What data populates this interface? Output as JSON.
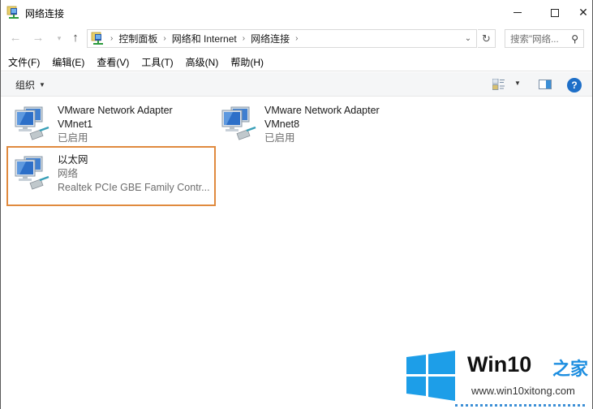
{
  "window": {
    "title": "网络连接"
  },
  "nav": {
    "back_icon": "arrow-left-icon",
    "forward_icon": "arrow-right-icon",
    "recent_icon": "chevron-down-icon",
    "up_icon": "arrow-up-icon",
    "breadcrumbs": [
      "控制面板",
      "网络和 Internet",
      "网络连接"
    ],
    "search_placeholder": "搜索\"网络..."
  },
  "menubar": {
    "items": [
      "文件(F)",
      "编辑(E)",
      "查看(V)",
      "工具(T)",
      "高级(N)",
      "帮助(H)"
    ]
  },
  "cmdbar": {
    "organize_label": "组织"
  },
  "connections": [
    {
      "name": "VMware Network Adapter",
      "line2": "VMnet1",
      "line3": "已启用"
    },
    {
      "name": "VMware Network Adapter",
      "line2": "VMnet8",
      "line3": "已启用"
    },
    {
      "name": "以太网",
      "line2": "网络",
      "line3": "Realtek PCIe GBE Family Contr..."
    }
  ],
  "highlight": {
    "color": "#e08a3e",
    "target": "以太网"
  },
  "watermark": {
    "brand": "Win10",
    "brand_cn": "之家",
    "url": "www.win10xitong.com",
    "accent": "#1d8ee0"
  }
}
